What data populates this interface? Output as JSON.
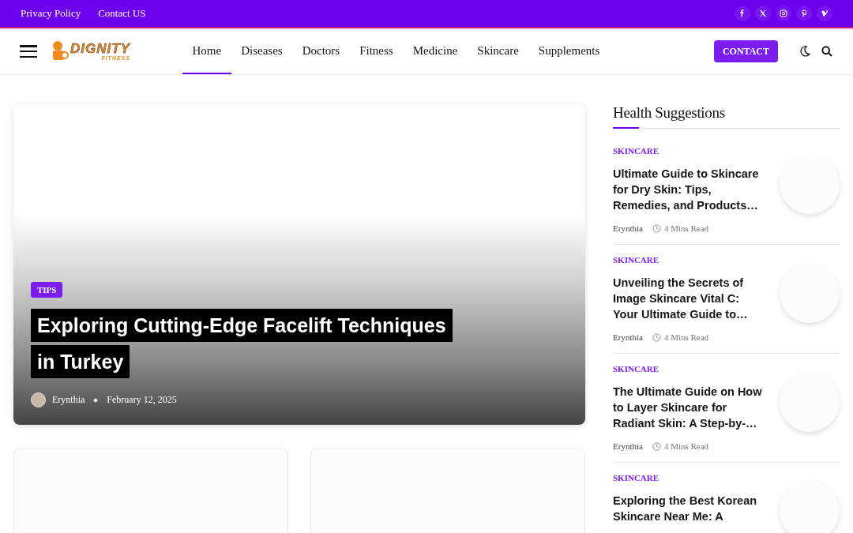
{
  "top_bar": {
    "links": [
      "Privacy Policy",
      "Contact US"
    ],
    "social": [
      {
        "kind": "facebook"
      },
      {
        "kind": "x"
      },
      {
        "kind": "instagram"
      },
      {
        "kind": "pinterest"
      },
      {
        "kind": "vimeo"
      }
    ]
  },
  "header": {
    "logo": {
      "name": "DIGNITY",
      "tagline": "FITNESS"
    },
    "nav": [
      {
        "label": "Home",
        "selected": true
      },
      {
        "label": "Diseases",
        "selected": false
      },
      {
        "label": "Doctors",
        "selected": false
      },
      {
        "label": "Fitness",
        "selected": false
      },
      {
        "label": "Medicine",
        "selected": false
      },
      {
        "label": "Skincare",
        "selected": false
      },
      {
        "label": "Supplements",
        "selected": false
      }
    ],
    "contact_button": "CONTACT"
  },
  "featured": {
    "category": "TIPS",
    "title_lines": [
      "Exploring Cutting-Edge Facelift Techniques",
      "in Turkey"
    ],
    "author": "Erynthia",
    "date": "February 12, 2025"
  },
  "cards": [
    {
      "kind": "empty"
    },
    {
      "kind": "empty"
    }
  ],
  "sidebar": {
    "title": "Health Suggestions",
    "posts": [
      {
        "category": "SKINCARE",
        "title": "Ultimate Guide to Skincare for Dry Skin: Tips, Remedies, and Products…",
        "author": "Erynthia",
        "read_time": "4 Mins Read"
      },
      {
        "category": "SKINCARE",
        "title": "Unveiling the Secrets of Image Skincare Vital C: Your Ultimate Guide to…",
        "author": "Erynthia",
        "read_time": "4 Mins Read"
      },
      {
        "category": "SKINCARE",
        "title": "The Ultimate Guide on How to Layer Skincare for Radiant Skin: A Step-by-…",
        "author": "Erynthia",
        "read_time": "4 Mins Read"
      },
      {
        "category": "SKINCARE",
        "title": "Exploring the Best Korean Skincare Near Me: A"
      }
    ]
  }
}
